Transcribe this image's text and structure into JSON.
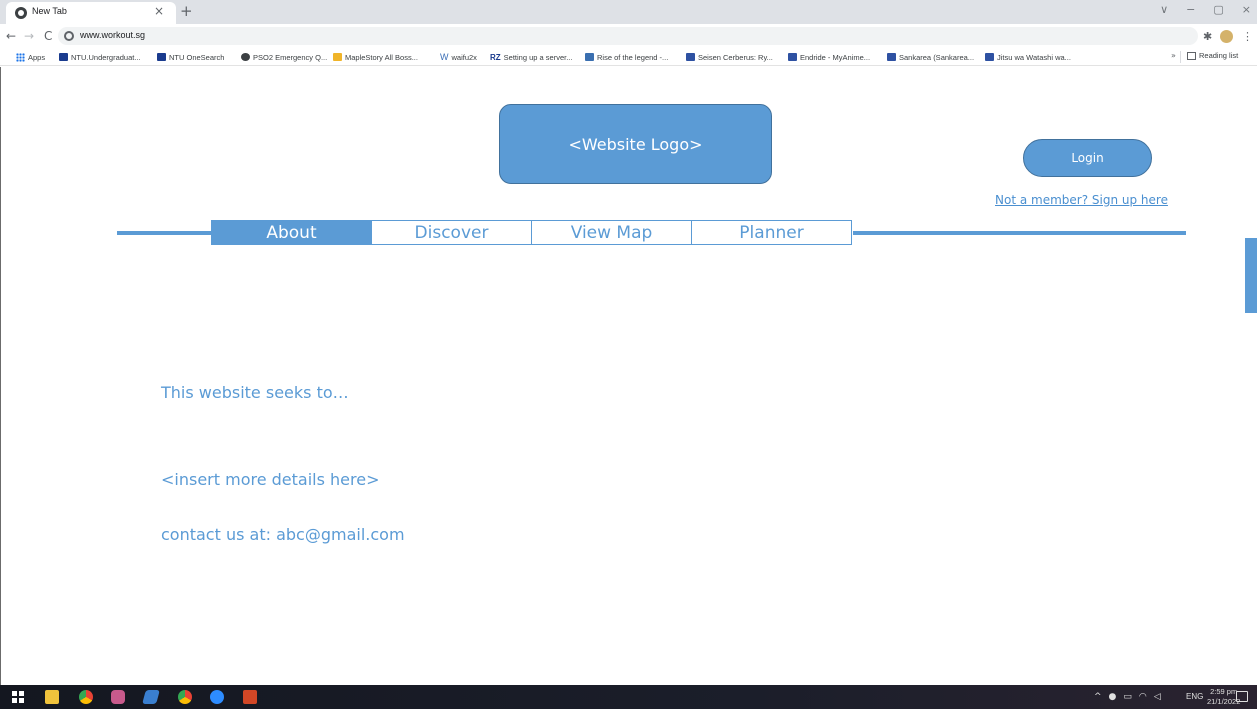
{
  "browser": {
    "tab_title": "New Tab",
    "tab_close": "×",
    "new_tab": "+",
    "url": "www.workout.sg",
    "window_controls": [
      "∨",
      "−",
      "▢",
      "×"
    ],
    "bookmarks": [
      {
        "label": "Apps",
        "icon": "apps-grid-icon"
      },
      {
        "label": "NTU.Undergraduat...",
        "icon": "ntu-icon"
      },
      {
        "label": "NTU OneSearch",
        "icon": "ntu-icon"
      },
      {
        "label": "PSO2 Emergency Q...",
        "icon": "globe-icon"
      },
      {
        "label": "MapleStory All Boss...",
        "icon": "maple-icon"
      },
      {
        "label": "waifu2x",
        "icon": "w-icon"
      },
      {
        "label": "Setting up a server...",
        "icon": "rz-icon"
      },
      {
        "label": "Rise of the legend -...",
        "icon": "puzzle-icon"
      },
      {
        "label": "Seisen Cerberus: Ry...",
        "icon": "myanimelist-icon"
      },
      {
        "label": "Endride - MyAnime...",
        "icon": "myanimelist-icon"
      },
      {
        "label": "Sankarea (Sankarea...",
        "icon": "myanimelist-icon"
      },
      {
        "label": "Jitsu wa Watashi wa...",
        "icon": "myanimelist-icon"
      }
    ],
    "bookmarks_overflow": "»",
    "reading_list": "Reading list"
  },
  "page": {
    "logo_text": "<Website Logo>",
    "login_label": "Login",
    "signup_link": "Not a member? Sign up here",
    "nav_tabs": [
      {
        "label": "About",
        "active": true
      },
      {
        "label": "Discover",
        "active": false
      },
      {
        "label": "View Map",
        "active": false
      },
      {
        "label": "Planner",
        "active": false
      }
    ],
    "intro": "This website seeks to…",
    "details": "<insert more details here>",
    "contact": "contact us at: abc@gmail.com"
  },
  "taskbar": {
    "language": "ENG",
    "time": "2:59 pm",
    "date": "21/1/2022"
  },
  "colors": {
    "accent": "#5b9bd5",
    "accent_border": "#41719c",
    "link": "#4a8fd0"
  }
}
